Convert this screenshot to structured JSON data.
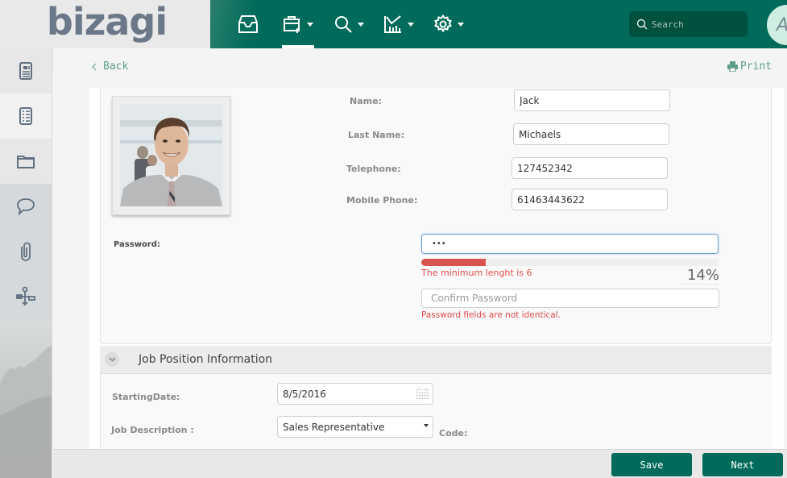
{
  "header": {
    "logo_text": "bizagi",
    "nav": [
      {
        "name": "inbox",
        "icon": "inbox-icon",
        "has_dropdown": false,
        "active": false
      },
      {
        "name": "new-case",
        "icon": "new-case-icon",
        "has_dropdown": true,
        "active": true
      },
      {
        "name": "search",
        "icon": "search-icon",
        "has_dropdown": true,
        "active": false
      },
      {
        "name": "analytics",
        "icon": "chart-icon",
        "has_dropdown": true,
        "active": false
      },
      {
        "name": "admin",
        "icon": "gear-icon",
        "has_dropdown": true,
        "active": false
      }
    ],
    "search_placeholder": "Search",
    "avatar_initial": "A"
  },
  "sidebar": {
    "items": [
      {
        "name": "case-info",
        "icon": "document-icon",
        "active": false
      },
      {
        "name": "forms",
        "icon": "list-document-icon",
        "active": true
      },
      {
        "name": "folders",
        "icon": "folder-icon",
        "active": false
      },
      {
        "name": "comments",
        "icon": "speech-bubble-icon",
        "active": false
      },
      {
        "name": "attachments",
        "icon": "paperclip-icon",
        "active": false
      },
      {
        "name": "workflow",
        "icon": "process-map-icon",
        "active": false
      }
    ]
  },
  "toolbar": {
    "back_label": "Back",
    "print_label": "Print"
  },
  "personal": {
    "fields": [
      {
        "label": "Name:",
        "value": "Jack"
      },
      {
        "label": "Last Name:",
        "value": "Michaels"
      },
      {
        "label": "Telephone:",
        "value": "127452342"
      },
      {
        "label": "Mobile Phone:",
        "value": "61463443622"
      }
    ],
    "password": {
      "label": "Password:",
      "value": "•••",
      "strength_percent": 14,
      "strength_text": "14%",
      "min_length_error": "The minimum lenght is 6",
      "confirm_placeholder": "Confirm Password",
      "mismatch_error": "Password fields are not identical."
    }
  },
  "job_section": {
    "title": "Job Position Information",
    "starting_date_label": "StartingDate:",
    "starting_date_value": "8/5/2016",
    "job_description_label": "Job Description :",
    "job_description_value": "Sales Representative",
    "code_label": "Code:"
  },
  "footer": {
    "save_label": "Save",
    "next_label": "Next"
  },
  "colors": {
    "brand": "#006b5a",
    "link": "#5e9e87",
    "error": "#e04b4b",
    "strength_bar": "#d9534f"
  }
}
